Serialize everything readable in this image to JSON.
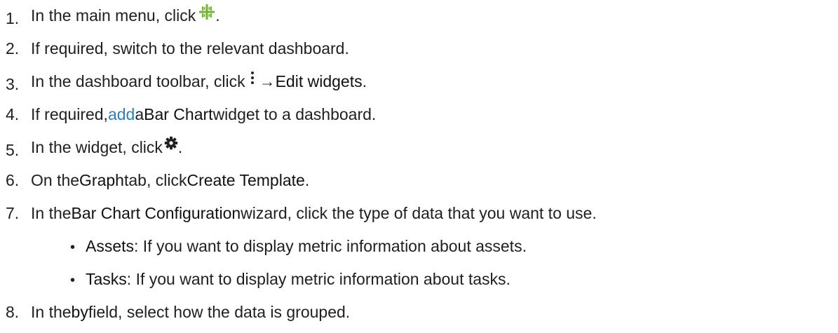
{
  "steps": [
    {
      "num": "1.",
      "pre": "In the main menu, click ",
      "icon": "main-menu-grid-icon",
      "post": "."
    },
    {
      "num": "2.",
      "text": "If required, switch to the relevant dashboard."
    },
    {
      "num": "3.",
      "pre": "In the dashboard toolbar, click ",
      "icon": "more-vertical-icon",
      "arrow": " → ",
      "bold": "Edit widgets",
      "post": "."
    },
    {
      "num": "4.",
      "pre": "If required, ",
      "link": "add",
      "mid": " a ",
      "bold": "Bar Chart",
      "post": " widget to a dashboard."
    },
    {
      "num": "5.",
      "pre": "In the widget, click ",
      "icon": "gear-icon",
      "post": " ."
    },
    {
      "num": "6.",
      "pre": "On the ",
      "bold1": "Graph",
      "mid": " tab, click ",
      "bold2": "Create Template",
      "post": "."
    },
    {
      "num": "7.",
      "pre": "In the ",
      "bold": "Bar Chart Configuration",
      "post": " wizard, click the type of data that you want to use."
    },
    {
      "num": "8.",
      "pre": "In the ",
      "bold": "by",
      "post": " field, select how the data is grouped."
    }
  ],
  "sub_items": [
    {
      "bullet": "•",
      "bold": "Assets",
      "text": ": If you want to display metric information about assets."
    },
    {
      "bullet": "•",
      "bold": "Tasks",
      "text": ": If you want to display metric information about tasks."
    }
  ],
  "colors": {
    "link": "#2b7fc4",
    "icon_green": "#6fb52c",
    "text": "#1f1f1f"
  }
}
